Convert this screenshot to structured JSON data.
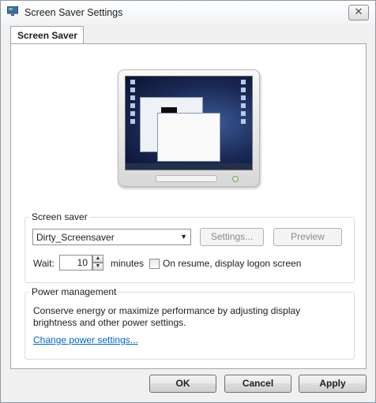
{
  "window": {
    "title": "Screen Saver Settings",
    "close_symbol": "✕"
  },
  "tabs": [
    {
      "label": "Screen Saver"
    }
  ],
  "screen_saver": {
    "group_label": "Screen saver",
    "selected": "Dirty_Screensaver",
    "settings_label": "Settings...",
    "preview_label": "Preview",
    "wait_label": "Wait:",
    "wait_value": "10",
    "minutes_label": "minutes",
    "resume_label": "On resume, display logon screen",
    "resume_checked": false
  },
  "power": {
    "group_label": "Power management",
    "description": "Conserve energy or maximize performance by adjusting display brightness and other power settings.",
    "link_label": "Change power settings..."
  },
  "buttons": {
    "ok": "OK",
    "cancel": "Cancel",
    "apply": "Apply"
  },
  "icons": {
    "window": "screen-saver-settings-icon",
    "dropdown": "chevron-down-icon",
    "spin_up": "spin-up-icon",
    "spin_down": "spin-down-icon"
  }
}
